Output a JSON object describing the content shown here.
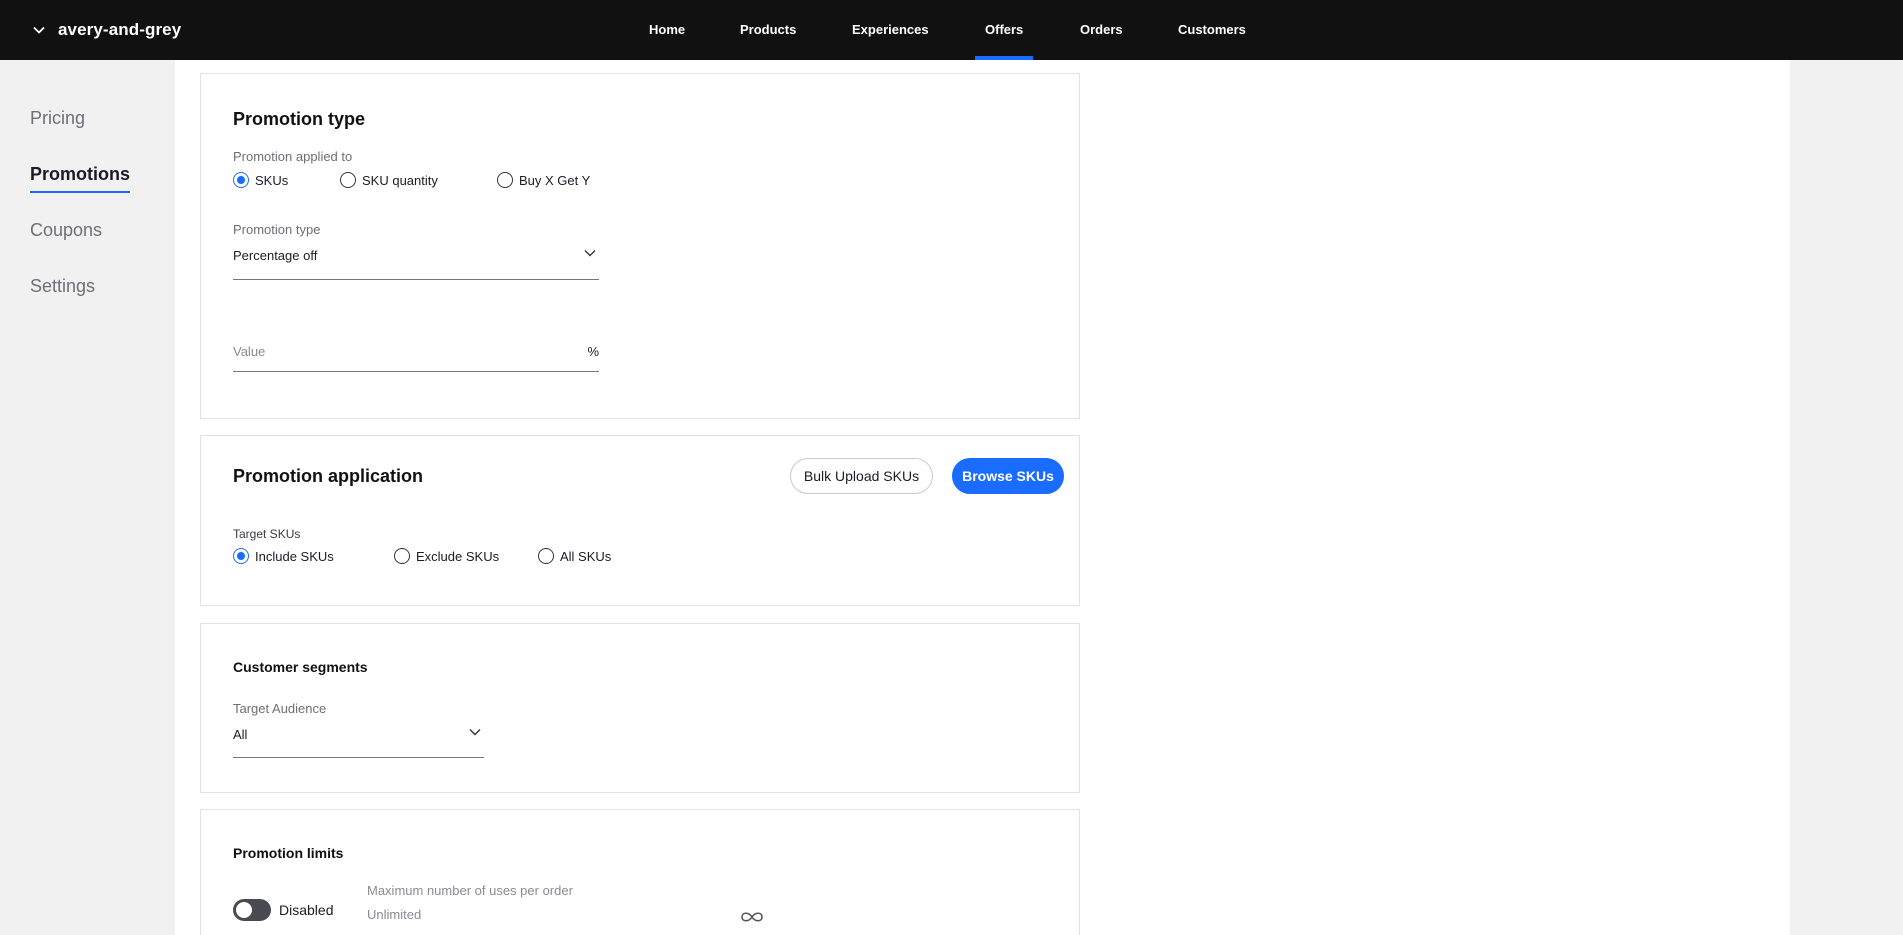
{
  "header": {
    "store_name": "avery-and-grey",
    "nav": [
      "Home",
      "Products",
      "Experiences",
      "Offers",
      "Orders",
      "Customers"
    ],
    "active_nav": "Offers"
  },
  "sidebar": {
    "items": [
      "Pricing",
      "Promotions",
      "Coupons",
      "Settings"
    ],
    "active": "Promotions"
  },
  "promotion_type_card": {
    "title": "Promotion type",
    "applied_to_label": "Promotion applied to",
    "applied_to_options": [
      "SKUs",
      "SKU quantity",
      "Buy X Get Y"
    ],
    "applied_to_selected": "SKUs",
    "type_label": "Promotion type",
    "type_value": "Percentage off",
    "value_placeholder": "Value",
    "value_suffix": "%"
  },
  "promotion_application_card": {
    "title": "Promotion application",
    "bulk_upload_label": "Bulk Upload SKUs",
    "browse_label": "Browse SKUs",
    "target_label": "Target SKUs",
    "target_options": [
      "Include SKUs",
      "Exclude SKUs",
      "All SKUs"
    ],
    "target_selected": "Include SKUs"
  },
  "customer_segments_card": {
    "title": "Customer segments",
    "audience_label": "Target Audience",
    "audience_value": "All"
  },
  "promotion_limits_card": {
    "title": "Promotion limits",
    "toggle_label": "Disabled",
    "toggle_on": false,
    "max_uses_label": "Maximum number of uses per order",
    "max_uses_value": "Unlimited"
  },
  "icons": {
    "store_chevron": "chevron-down-icon",
    "select_chevron": "chevron-down-icon",
    "infinity": "infinity-icon"
  },
  "colors": {
    "accent": "#1a6bff",
    "topbar": "#111111",
    "background": "#f1f1f2"
  }
}
